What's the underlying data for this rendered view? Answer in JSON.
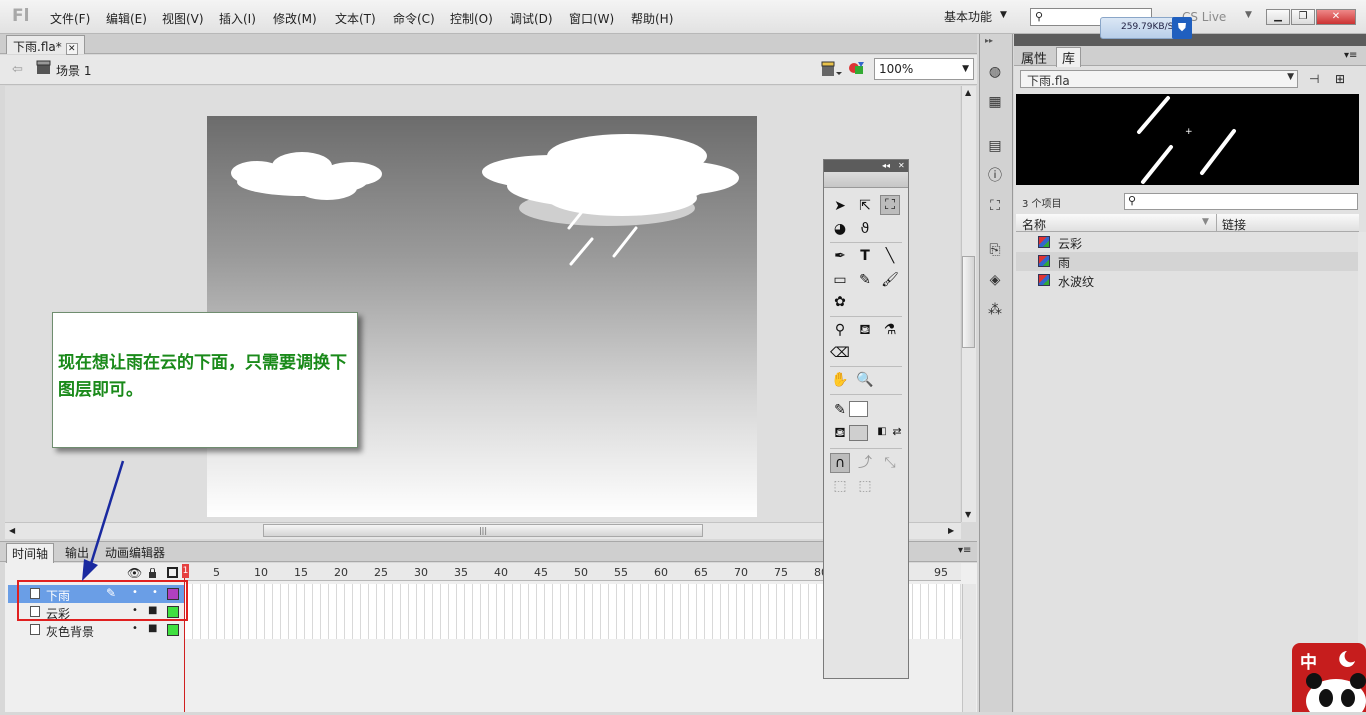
{
  "app": {
    "logo": "Fl"
  },
  "menu": [
    "文件(F)",
    "编辑(E)",
    "视图(V)",
    "插入(I)",
    "修改(M)",
    "文本(T)",
    "命令(C)",
    "控制(O)",
    "调试(D)",
    "窗口(W)",
    "帮助(H)"
  ],
  "workspace": {
    "label": "基本功能"
  },
  "network_badge": {
    "speed": "259.79KB/S"
  },
  "cs_live": {
    "label": "CS Live"
  },
  "document_tab": {
    "title": "下雨.fla*"
  },
  "scene": {
    "label": "场景 1"
  },
  "zoom": {
    "value": "100%"
  },
  "callout": {
    "text": "现在想让雨在云的下面，只需要调换下图层即可。"
  },
  "timeline": {
    "tabs": [
      "时间轴",
      "输出",
      "动画编辑器"
    ],
    "ruler": [
      "1",
      "5",
      "10",
      "15",
      "20",
      "25",
      "30",
      "35",
      "40",
      "45",
      "50",
      "55",
      "60",
      "65",
      "70",
      "75",
      "80",
      "85",
      "90",
      "95"
    ],
    "layers": [
      {
        "name": "下雨",
        "selected": true,
        "color": "#b040c0"
      },
      {
        "name": "云彩",
        "selected": false,
        "color": "#40e040"
      },
      {
        "name": "灰色背景",
        "selected": false,
        "color": "#40e040"
      }
    ]
  },
  "right_panel": {
    "tabs": [
      "属性",
      "库"
    ],
    "library_file": "下雨.fla",
    "item_count": "3 个项目",
    "columns": {
      "name": "名称",
      "link": "链接"
    },
    "items": [
      "云彩",
      "雨",
      "水波纹"
    ],
    "selected_item": "雨"
  },
  "corner_logo": {
    "text": "中"
  }
}
